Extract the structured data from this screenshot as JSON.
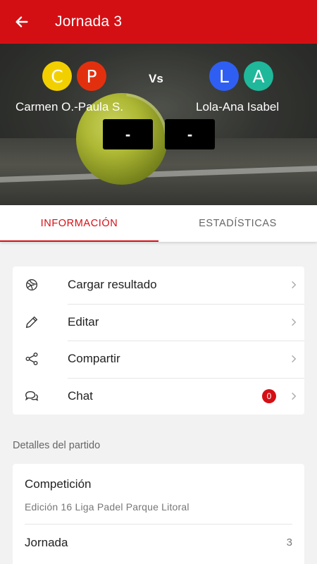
{
  "appbar": {
    "title": "Jornada 3"
  },
  "match": {
    "team1": {
      "name": "Carmen O.-Paula S.",
      "avatars": [
        {
          "letter": "C",
          "color": "#f2d000"
        },
        {
          "letter": "P",
          "color": "#e2300f"
        }
      ]
    },
    "team2": {
      "name": "Lola-Ana Isabel",
      "avatars": [
        {
          "letter": "L",
          "color": "#2f5ff2"
        },
        {
          "letter": "A",
          "color": "#1fb89b"
        }
      ]
    },
    "vs": "Vs",
    "score1": "-",
    "score2": "-"
  },
  "tabs": [
    {
      "label": "INFORMACIÓN",
      "active": true
    },
    {
      "label": "ESTADÍSTICAS",
      "active": false
    }
  ],
  "actions": [
    {
      "label": "Cargar resultado",
      "icon": "ball-icon"
    },
    {
      "label": "Editar",
      "icon": "pencil-icon"
    },
    {
      "label": "Compartir",
      "icon": "share-icon"
    },
    {
      "label": "Chat",
      "icon": "chat-icon",
      "badge": "0"
    }
  ],
  "details": {
    "section_label": "Detalles del partido",
    "competition": {
      "title": "Competición",
      "value": "Edición 16 Liga Padel Parque Litoral"
    },
    "jornada": {
      "label": "Jornada",
      "value": "3"
    }
  },
  "colors": {
    "primary": "#d40f14",
    "background": "#f2f2f2",
    "card": "#ffffff"
  }
}
